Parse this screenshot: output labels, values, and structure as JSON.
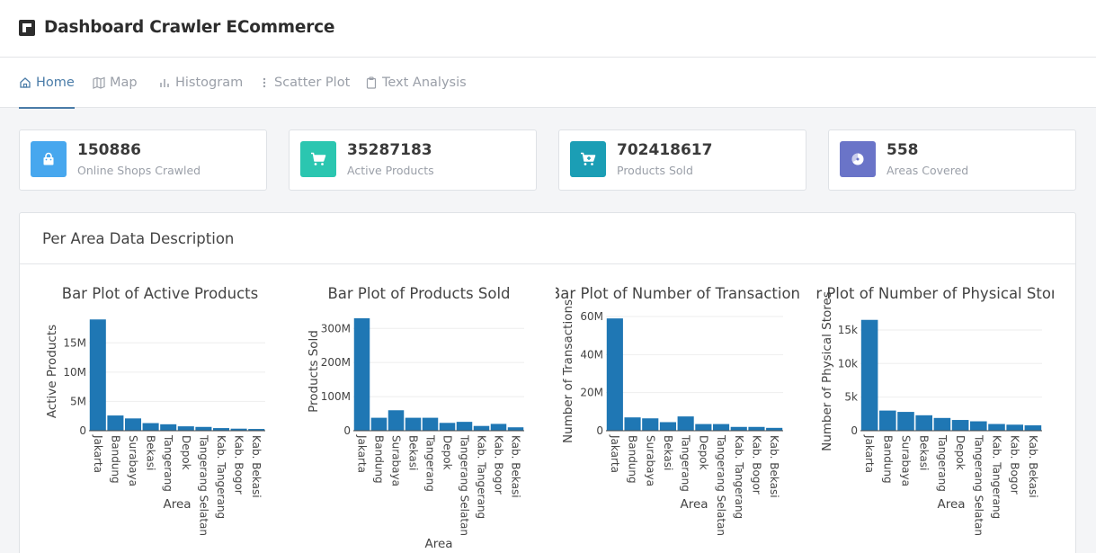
{
  "app": {
    "title": "Dashboard Crawler ECommerce"
  },
  "nav": {
    "tabs": [
      {
        "label": "Home",
        "icon": "home-icon",
        "active": true
      },
      {
        "label": "Map",
        "icon": "map-icon",
        "active": false
      },
      {
        "label": "Histogram",
        "icon": "bar-chart-icon",
        "active": false
      },
      {
        "label": "Scatter Plot",
        "icon": "more-vertical-icon",
        "active": false
      },
      {
        "label": "Text Analysis",
        "icon": "clipboard-icon",
        "active": false
      }
    ]
  },
  "stats": [
    {
      "value": "150886",
      "label": "Online Shops Crawled",
      "icon": "shopping-bag-icon",
      "color": "#47a7ee"
    },
    {
      "value": "35287183",
      "label": "Active Products",
      "icon": "shopping-cart-icon",
      "color": "#2bc6b0"
    },
    {
      "value": "702418617",
      "label": "Products Sold",
      "icon": "cart-plus-icon",
      "color": "#1b9eb5"
    },
    {
      "value": "558",
      "label": "Areas Covered",
      "icon": "pie-chart-icon",
      "color": "#6a74c8"
    }
  ],
  "panel": {
    "title": "Per Area Data Description"
  },
  "chart_data": [
    {
      "type": "bar",
      "title": "Bar Plot of Active Products",
      "xlabel": "Area",
      "ylabel": "Active Products",
      "categories": [
        "Jakarta",
        "Bandung",
        "Surabaya",
        "Bekasi",
        "Tangerang",
        "Depok",
        "Tangerang Selatan",
        "Kab. Tangerang",
        "Kab. Bogor",
        "Kab. Bekasi"
      ],
      "values": [
        19000000,
        2600000,
        2100000,
        1300000,
        1100000,
        750000,
        650000,
        450000,
        350000,
        300000
      ],
      "ylim": [
        0,
        19500000
      ],
      "yticks": [
        0,
        5000000,
        10000000,
        15000000
      ],
      "yticklabels": [
        "0",
        "5M",
        "10M",
        "15M"
      ],
      "color": "#1f77b4"
    },
    {
      "type": "bar",
      "title": "Bar Plot of Products Sold",
      "xlabel": "Area",
      "ylabel": "Products Sold",
      "categories": [
        "Jakarta",
        "Bandung",
        "Surabaya",
        "Bekasi",
        "Tangerang",
        "Depok",
        "Tangerang Selatan",
        "Kab. Tangerang",
        "Kab. Bogor",
        "Kab. Bekasi"
      ],
      "values": [
        330000000,
        38000000,
        60000000,
        38000000,
        38000000,
        23000000,
        26000000,
        14000000,
        20000000,
        10000000
      ],
      "ylim": [
        0,
        335000000
      ],
      "yticks": [
        0,
        100000000,
        200000000,
        300000000
      ],
      "yticklabels": [
        "0",
        "100M",
        "200M",
        "300M"
      ],
      "color": "#1f77b4"
    },
    {
      "type": "bar",
      "title": "Bar Plot of Number of Transaction",
      "xlabel": "Area",
      "ylabel": "Number of Transactions",
      "categories": [
        "Jakarta",
        "Bandung",
        "Surabaya",
        "Bekasi",
        "Tangerang",
        "Depok",
        "Tangerang Selatan",
        "Kab. Tangerang",
        "Kab. Bogor",
        "Kab. Bekasi"
      ],
      "values": [
        59000000,
        7000000,
        6500000,
        4500000,
        7500000,
        3500000,
        3500000,
        2000000,
        2000000,
        1500000
      ],
      "ylim": [
        0,
        60000000
      ],
      "yticks": [
        0,
        20000000,
        40000000,
        60000000
      ],
      "yticklabels": [
        "0",
        "20M",
        "40M",
        "60M"
      ],
      "color": "#1f77b4"
    },
    {
      "type": "bar",
      "title": "Bar Plot of Number of Physical Stores",
      "xlabel": "Area",
      "ylabel": "Number of Physical Stores",
      "categories": [
        "Jakarta",
        "Bandung",
        "Surabaya",
        "Bekasi",
        "Tangerang",
        "Depok",
        "Tangerang Selatan",
        "Kab. Tangerang",
        "Kab. Bogor",
        "Kab. Bekasi"
      ],
      "values": [
        16500,
        3000,
        2800,
        2300,
        1900,
        1600,
        1400,
        1000,
        900,
        800
      ],
      "ylim": [
        0,
        17000
      ],
      "yticks": [
        0,
        5000,
        10000,
        15000
      ],
      "yticklabels": [
        "0",
        "5k",
        "10k",
        "15k"
      ],
      "color": "#1f77b4"
    }
  ]
}
